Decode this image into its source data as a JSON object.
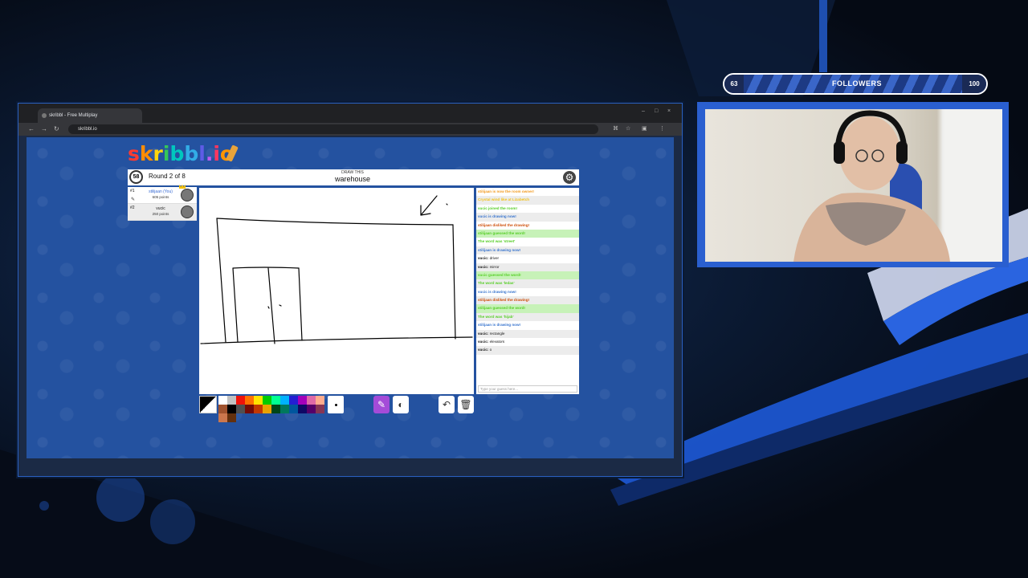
{
  "browser": {
    "tab_title": "skribbl - Free Multiplay",
    "url": "skribbl.io",
    "window_controls": [
      "–",
      "□",
      "×"
    ]
  },
  "game": {
    "logo_letters": [
      "s",
      "k",
      "r",
      "i",
      "b",
      "b",
      "l",
      ".",
      "i",
      "o"
    ],
    "logo_colors": [
      "#ff3b30",
      "#ff8c00",
      "#ffd60a",
      "#34c759",
      "#00c7be",
      "#32ade6",
      "#5e5ce6",
      "#bf5af2",
      "#ff375f",
      "#ff9500"
    ],
    "timer": "58",
    "round_text": "Round 2 of 8",
    "hint_label": "DRAW THIS",
    "word": "warehouse",
    "players": [
      {
        "rank": "#1",
        "name": "stilijaan (You)",
        "points": "605 points",
        "is_drawing": true
      },
      {
        "rank": "#2",
        "name": "vucic",
        "points": "250 points",
        "is_drawing": false
      }
    ],
    "chat": [
      {
        "text": "stilijaan is now the room owner!",
        "color": "#f29a1f",
        "alt": false
      },
      {
        "text": "Crystal wind like at Lizabetch",
        "color": "#f2c21f",
        "alt": true
      },
      {
        "text": "vucic joined the room!",
        "color": "#56ce27",
        "alt": false
      },
      {
        "text": "vucic is drawing now!",
        "color": "#3975ce",
        "alt": true
      },
      {
        "text": "stilijaan disliked the drawing!",
        "color": "#ce4f0a",
        "alt": false
      },
      {
        "text": "stilijaan guessed the word!",
        "color": "#56ce27",
        "alt": true,
        "highlight": true
      },
      {
        "text": "The word was 'street'",
        "color": "#56ce27",
        "alt": false
      },
      {
        "text": "stilijaan is drawing now!",
        "color": "#3975ce",
        "alt": true
      },
      {
        "user": "vucic:",
        "text": "driver",
        "color": "#111111",
        "alt": false
      },
      {
        "user": "vucic:",
        "text": "mirror",
        "color": "#111111",
        "alt": true
      },
      {
        "text": "vucic guessed the word!",
        "color": "#56ce27",
        "alt": false,
        "highlight": true
      },
      {
        "text": "The word was 'ledas'",
        "color": "#56ce27",
        "alt": true
      },
      {
        "text": "vucic is drawing now!",
        "color": "#3975ce",
        "alt": false
      },
      {
        "text": "stilijaan disliked the drawing!",
        "color": "#ce4f0a",
        "alt": true
      },
      {
        "text": "stilijaan guessed the word!",
        "color": "#56ce27",
        "alt": false,
        "highlight": true
      },
      {
        "text": "The word was 'hijab'",
        "color": "#56ce27",
        "alt": true
      },
      {
        "text": "stilijaan is drawing now!",
        "color": "#3975ce",
        "alt": false
      },
      {
        "user": "vucic:",
        "text": "rectangle",
        "color": "#111111",
        "alt": true
      },
      {
        "user": "vucic:",
        "text": "elevators",
        "color": "#111111",
        "alt": false
      },
      {
        "user": "vucic:",
        "text": "o",
        "color": "#111111",
        "alt": true
      }
    ],
    "chat_placeholder": "Type your guess here...",
    "palette": [
      "#ffffff",
      "#c1c1c1",
      "#ef130b",
      "#ff7100",
      "#ffe400",
      "#00cc00",
      "#00ff91",
      "#00b2ff",
      "#231fd3",
      "#a300ba",
      "#df69a7",
      "#ffac8e",
      "#a0522d",
      "#000000",
      "#505050",
      "#740b07",
      "#c23800",
      "#e8a200",
      "#004619",
      "#00785d",
      "#00569e",
      "#0e0865",
      "#550069",
      "#873554",
      "#cc774d",
      "#63300d"
    ],
    "tools": {
      "pen": "pen-icon",
      "fill": "fill-icon",
      "undo": "undo-icon",
      "clear": "trash-icon"
    }
  },
  "overlay": {
    "followers_current": "63",
    "followers_label": "FOLLOWERS",
    "followers_goal": "100"
  }
}
